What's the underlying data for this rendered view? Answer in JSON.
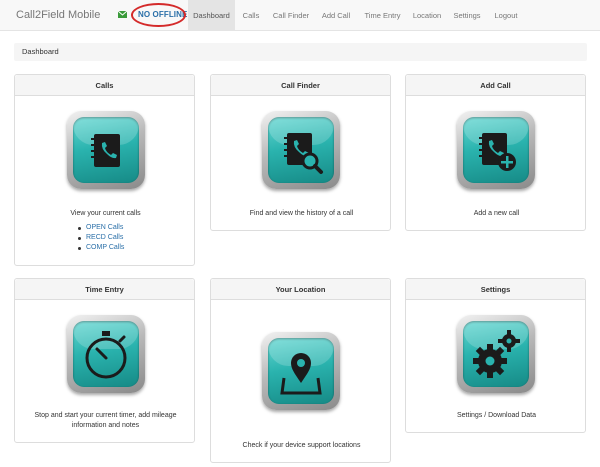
{
  "navbar": {
    "brand": "Call2Field Mobile",
    "offline_label": "NO OFFLINE",
    "items": [
      {
        "label": "Dashboard"
      },
      {
        "label": "Calls"
      },
      {
        "label": "Call Finder"
      },
      {
        "label": "Add Call"
      },
      {
        "label": "Time Entry"
      },
      {
        "label": "Location"
      },
      {
        "label": "Settings"
      },
      {
        "label": "Logout"
      }
    ]
  },
  "breadcrumb": {
    "current": "Dashboard"
  },
  "panels": {
    "calls": {
      "title": "Calls",
      "description": "View your current calls",
      "links": [
        "OPEN Calls",
        "RECD Calls",
        "COMP Calls"
      ],
      "icon": "phone-book-icon"
    },
    "call_finder": {
      "title": "Call Finder",
      "description": "Find and view the history of a call",
      "icon": "phone-book-search-icon"
    },
    "add_call": {
      "title": "Add Call",
      "description": "Add a new call",
      "icon": "phone-book-add-icon"
    },
    "time_entry": {
      "title": "Time Entry",
      "description_line1": "Stop and start your current timer, add mileage",
      "description_line2": "information and notes",
      "icon": "stopwatch-icon"
    },
    "location": {
      "title": "Your Location",
      "description": "Check if your device support locations",
      "icon": "map-pin-icon"
    },
    "settings": {
      "title": "Settings",
      "description": "Settings / Download Data",
      "icon": "gears-icon"
    }
  },
  "colors": {
    "tile_teal": "#2ab3ae",
    "link_blue": "#2a6fa8",
    "offline_ring": "#d42a2a",
    "nav_bg": "#f8f8f8"
  }
}
